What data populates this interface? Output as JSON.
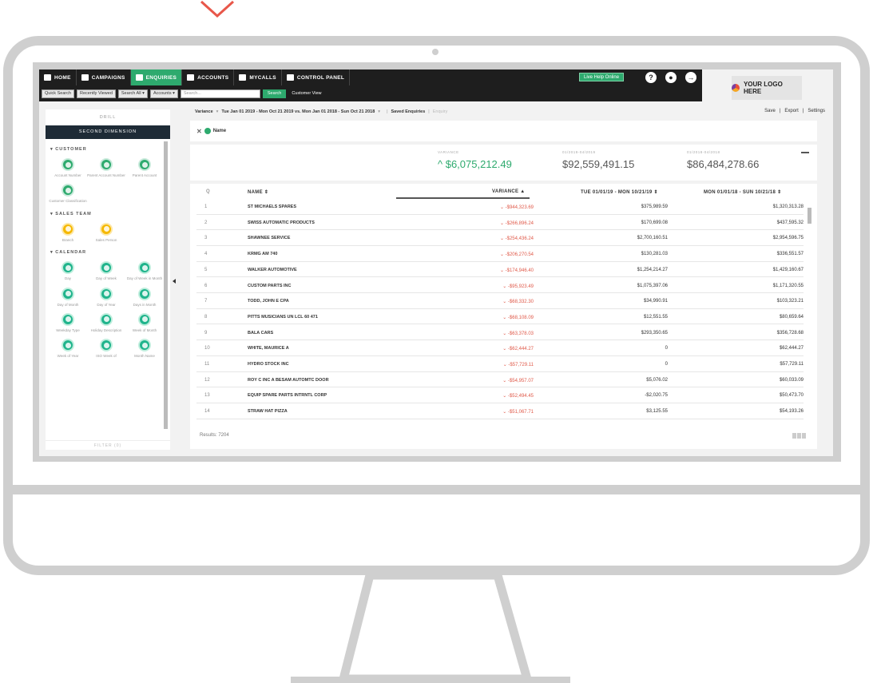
{
  "nav": {
    "items": [
      {
        "label": "HOME",
        "active": false
      },
      {
        "label": "CAMPAIGNS",
        "active": false
      },
      {
        "label": "ENQUIRIES",
        "active": true
      },
      {
        "label": "ACCOUNTS",
        "active": false
      },
      {
        "label": "MYCALLS",
        "active": false
      },
      {
        "label": "CONTROL PANEL",
        "active": false
      }
    ],
    "live_help": "Live Help Online",
    "help_icon": "?",
    "logo_text": "YOUR LOGO HERE"
  },
  "subnav": {
    "quick_search": "Quick Search",
    "recently_viewed": "Recently Viewed",
    "search_all": "Search All",
    "accounts": "Accounts",
    "search_placeholder": "Search...",
    "search_button": "Search",
    "customer_view": "Customer View"
  },
  "sidebar": {
    "drill": "DRILL",
    "second_dimension": "SECOND DIMENSION",
    "sections": [
      {
        "title": "CUSTOMER",
        "color": "g",
        "items": [
          "Account Number",
          "Parent Account Number",
          "Parent Account",
          "Customer Classification"
        ]
      },
      {
        "title": "SALES TEAM",
        "color": "y",
        "items": [
          "Branch",
          "Sales Person"
        ]
      },
      {
        "title": "CALENDAR",
        "color": "t",
        "items": [
          "Day",
          "Day of Week",
          "Day of Week in Month",
          "Day of Month",
          "Day of Year",
          "Days in Month",
          "Weekday Type",
          "Holiday Description",
          "Week of Month",
          "Week of Year",
          "ISO Week of",
          "Month Name"
        ]
      }
    ],
    "filter": "FILTER (0)"
  },
  "toolbar": {
    "variance": "Variance",
    "dates": "Tue Jan 01 2019 - Mon Oct 21 2019 vs. Mon Jan 01 2018 - Sun Oct 21 2018",
    "saved": "Saved Enquiries",
    "enquiry": "Enquiry",
    "save": "Save",
    "export": "Export",
    "settings": "Settings"
  },
  "filterbar": {
    "name": "Name"
  },
  "summary": {
    "variance_cap": "VARIANCE",
    "variance_val": "^ $6,075,212.49",
    "p1_cap": "01/2019-04/2019",
    "p1_val": "$92,559,491.15",
    "p2_cap": "01/2018-04/2018",
    "p2_val": "$86,484,278.66"
  },
  "table": {
    "headers": {
      "search": "Q",
      "name": "NAME ⇕",
      "variance": "VARIANCE ▲",
      "p1": "TUE 01/01/19 - MON 10/21/19 ⇕",
      "p2": "MON 01/01/18 - SUN 10/21/18 ⇕"
    },
    "rows": [
      {
        "n": "1",
        "name": "ST MICHAELS SPARES",
        "var": "⌄ -$944,323.69",
        "p1": "$375,989.59",
        "p2": "$1,320,313.28"
      },
      {
        "n": "2",
        "name": "SWISS AUTOMATIC PRODUCTS",
        "var": "⌄ -$266,896.24",
        "p1": "$170,699.08",
        "p2": "$437,595.32"
      },
      {
        "n": "3",
        "name": "SHAWNEE SERVICE",
        "var": "⌄ -$254,436.24",
        "p1": "$2,700,160.51",
        "p2": "$2,954,596.75"
      },
      {
        "n": "4",
        "name": "KRMG AM 740",
        "var": "⌄ -$206,270.54",
        "p1": "$130,281.03",
        "p2": "$336,551.57"
      },
      {
        "n": "5",
        "name": "WALKER AUTOMOTIVE",
        "var": "⌄ -$174,946.40",
        "p1": "$1,254,214.27",
        "p2": "$1,429,160.67"
      },
      {
        "n": "6",
        "name": "CUSTOM PARTS INC",
        "var": "⌄ -$95,923.49",
        "p1": "$1,075,397.06",
        "p2": "$1,171,320.55"
      },
      {
        "n": "7",
        "name": "TODD, JOHN E CPA",
        "var": "⌄ -$68,332.30",
        "p1": "$34,990.91",
        "p2": "$103,323.21"
      },
      {
        "n": "8",
        "name": "PITTS MUSICIANS UN LCL 60 471",
        "var": "⌄ -$68,108.09",
        "p1": "$12,551.55",
        "p2": "$80,659.64"
      },
      {
        "n": "9",
        "name": "BALA CARS",
        "var": "⌄ -$63,378.03",
        "p1": "$293,350.65",
        "p2": "$356,728.68"
      },
      {
        "n": "10",
        "name": "WHITE, MAURICE A",
        "var": "⌄ -$62,444.27",
        "p1": "0",
        "p2": "$62,444.27"
      },
      {
        "n": "11",
        "name": "HYDRO STOCK INC",
        "var": "⌄ -$57,729.11",
        "p1": "0",
        "p2": "$57,729.11"
      },
      {
        "n": "12",
        "name": "ROY C INC A BESAM AUTOMTC DOOR",
        "var": "⌄ -$54,957.07",
        "p1": "$5,076.02",
        "p2": "$60,033.09"
      },
      {
        "n": "13",
        "name": "EQUIP SPARE PARTS INTRNTL CORP",
        "var": "⌄ -$52,494.45",
        "p1": "-$2,020.75",
        "p2": "$50,473.70"
      },
      {
        "n": "14",
        "name": "STRAW HAT PIZZA",
        "var": "⌄ -$51,067.71",
        "p1": "$3,125.55",
        "p2": "$54,193.26"
      }
    ],
    "results": "Results: 7204"
  }
}
